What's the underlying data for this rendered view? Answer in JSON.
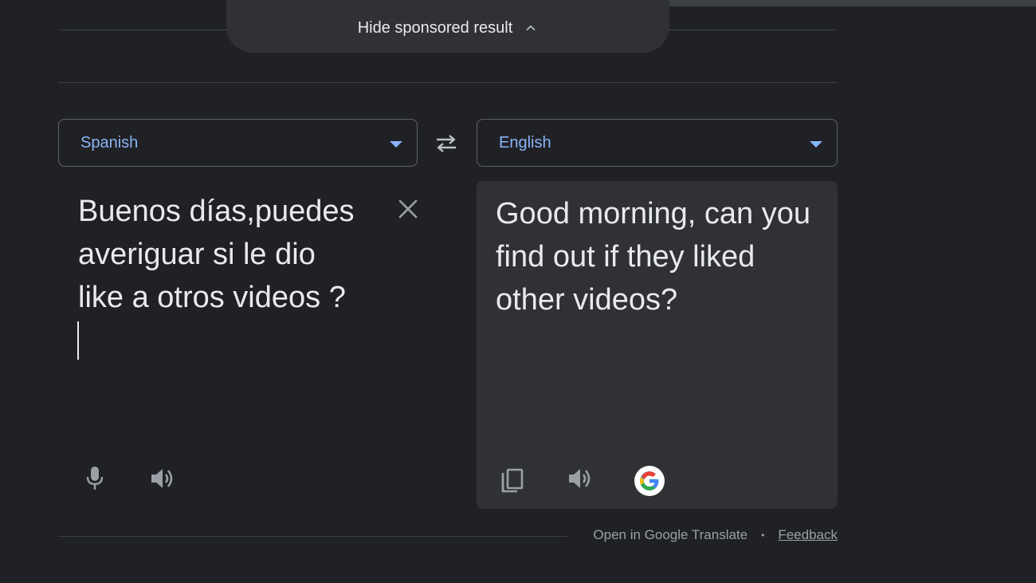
{
  "sponsored": {
    "hide_label": "Hide sponsored result"
  },
  "source": {
    "language": "Spanish",
    "text": "Buenos días,puedes\naveriguar si le dio\nlike a otros videos ?"
  },
  "target": {
    "language": "English",
    "text": "Good morning, can you find out if they liked other videos?"
  },
  "footer": {
    "open_label": "Open in Google Translate",
    "separator": "•",
    "feedback_label": "Feedback"
  },
  "colors": {
    "background": "#202124",
    "panel": "#303134",
    "accent": "#8ab4f8",
    "icon": "#9aa0a6"
  },
  "icons": [
    "chevron-up-icon",
    "swap-icon",
    "close-icon",
    "microphone-icon",
    "speaker-icon",
    "copy-icon",
    "google-logo-icon"
  ]
}
